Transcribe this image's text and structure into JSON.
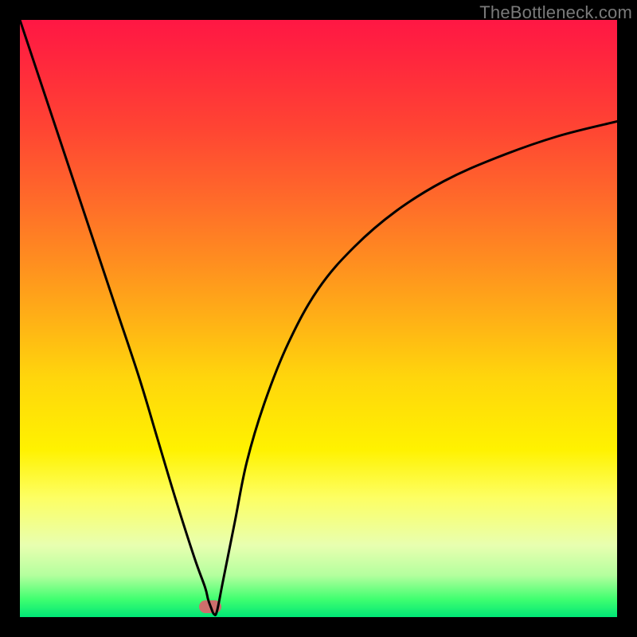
{
  "watermark": "TheBottleneck.com",
  "chart_data": {
    "type": "line",
    "title": "",
    "xlabel": "",
    "ylabel": "",
    "xlim": [
      0,
      100
    ],
    "ylim": [
      0,
      100
    ],
    "series": [
      {
        "name": "curve",
        "x": [
          0,
          4,
          8,
          12,
          16,
          20,
          23,
          26,
          29.2,
          31,
          31.5,
          32.0,
          32.5,
          33,
          34,
          36,
          38,
          41,
          45,
          50,
          56,
          63,
          71,
          80,
          90,
          100
        ],
        "values": [
          100,
          88,
          76,
          64,
          52,
          40,
          30,
          20,
          10,
          5,
          3,
          1.6,
          0.5,
          1,
          6,
          16,
          26,
          36,
          46,
          55,
          62,
          68,
          73,
          77,
          80.5,
          83
        ]
      }
    ],
    "marker": {
      "x": 31.9,
      "y": 1.8
    },
    "grid": false,
    "legend": false
  }
}
